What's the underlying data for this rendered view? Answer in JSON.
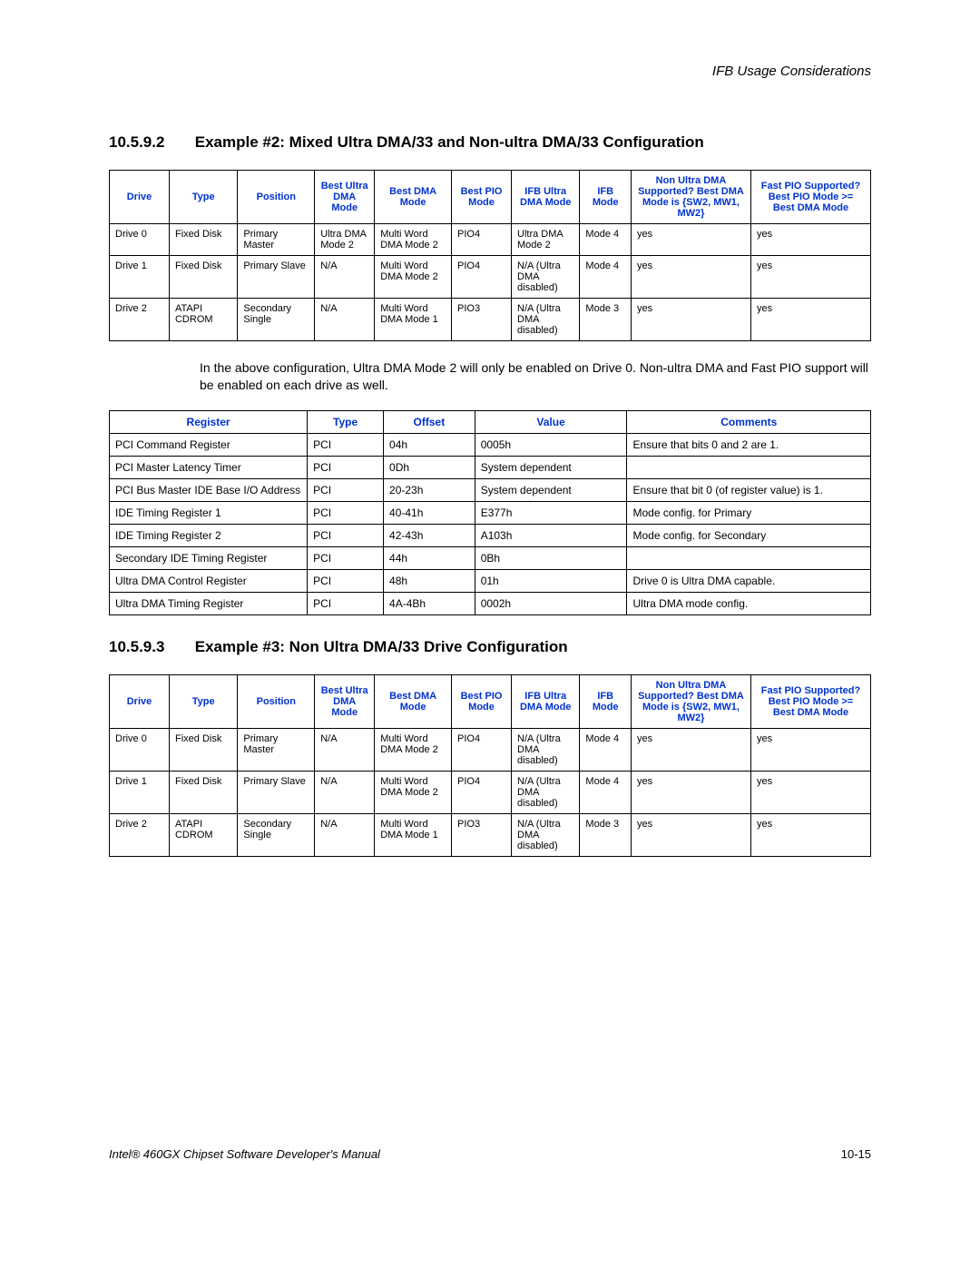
{
  "header": {
    "title": "IFB Usage Considerations"
  },
  "section1": {
    "num": "10.5.9.2",
    "title": "Example #2: Mixed Ultra DMA/33 and Non-ultra DMA/33 Configuration"
  },
  "table1": {
    "headers": [
      "Drive",
      "Type",
      "Position",
      "Best Ultra DMA Mode",
      "Best DMA Mode",
      "Best PIO Mode",
      "IFB Ultra DMA Mode",
      "IFB Mode",
      "Non Ultra DMA Supported? Best DMA Mode is {SW2, MW1, MW2}",
      "Fast PIO Supported? Best PIO Mode >= Best DMA Mode"
    ],
    "rows": [
      [
        "Drive 0",
        "Fixed Disk",
        "Primary Master",
        "Ultra DMA Mode 2",
        "Multi Word DMA Mode 2",
        "PIO4",
        "Ultra DMA Mode 2",
        "Mode 4",
        "yes",
        "yes"
      ],
      [
        "Drive 1",
        "Fixed Disk",
        "Primary Slave",
        "N/A",
        "Multi Word DMA Mode 2",
        "PIO4",
        "N/A (Ultra DMA disabled)",
        "Mode 4",
        "yes",
        "yes"
      ],
      [
        "Drive 2",
        "ATAPI CDROM",
        "Secondary Single",
        "N/A",
        "Multi Word DMA Mode 1",
        "PIO3",
        "N/A (Ultra DMA disabled)",
        "Mode 3",
        "yes",
        "yes"
      ]
    ]
  },
  "paragraph1": "In the above configuration, Ultra DMA Mode 2 will only be enabled on Drive 0. Non-ultra DMA and Fast PIO support will be enabled on each drive as well.",
  "table2": {
    "headers": [
      "Register",
      "Type",
      "Offset",
      "Value",
      "Comments"
    ],
    "rows": [
      [
        "PCI Command Register",
        "PCI",
        "04h",
        "0005h",
        "Ensure that bits 0 and 2 are 1."
      ],
      [
        "PCI Master Latency Timer",
        "PCI",
        "0Dh",
        "System dependent",
        ""
      ],
      [
        "PCI Bus Master IDE Base I/O Address",
        "PCI",
        "20-23h",
        "System dependent",
        "Ensure that bit 0 (of register value) is 1."
      ],
      [
        "IDE Timing Register 1",
        "PCI",
        "40-41h",
        "E377h",
        "Mode config. for Primary"
      ],
      [
        "IDE Timing Register 2",
        "PCI",
        "42-43h",
        "A103h",
        "Mode config. for Secondary"
      ],
      [
        "Secondary IDE Timing Register",
        "PCI",
        "44h",
        "0Bh",
        ""
      ],
      [
        "Ultra DMA Control Register",
        "PCI",
        "48h",
        "01h",
        "Drive 0 is Ultra DMA capable."
      ],
      [
        "Ultra DMA Timing Register",
        "PCI",
        "4A-4Bh",
        "0002h",
        "Ultra DMA mode config."
      ]
    ]
  },
  "section2": {
    "num": "10.5.9.3",
    "title": "Example #3: Non Ultra DMA/33 Drive Configuration"
  },
  "table3": {
    "headers": [
      "Drive",
      "Type",
      "Position",
      "Best Ultra DMA Mode",
      "Best DMA Mode",
      "Best PIO Mode",
      "IFB Ultra DMA Mode",
      "IFB Mode",
      "Non Ultra DMA Supported? Best DMA Mode is {SW2, MW1, MW2}",
      "Fast PIO Supported? Best PIO Mode >= Best DMA Mode"
    ],
    "rows": [
      [
        "Drive 0",
        "Fixed Disk",
        "Primary Master",
        "N/A",
        "Multi Word DMA Mode 2",
        "PIO4",
        "N/A (Ultra DMA disabled)",
        "Mode 4",
        "yes",
        "yes"
      ],
      [
        "Drive 1",
        "Fixed Disk",
        "Primary Slave",
        "N/A",
        "Multi Word DMA Mode 2",
        "PIO4",
        "N/A (Ultra DMA disabled)",
        "Mode 4",
        "yes",
        "yes"
      ],
      [
        "Drive 2",
        "ATAPI CDROM",
        "Secondary Single",
        "N/A",
        "Multi Word DMA Mode 1",
        "PIO3",
        "N/A (Ultra DMA disabled)",
        "Mode 3",
        "yes",
        "yes"
      ]
    ]
  },
  "footer": {
    "left": "Intel® 460GX Chipset Software Developer's Manual",
    "right": "10-15"
  }
}
